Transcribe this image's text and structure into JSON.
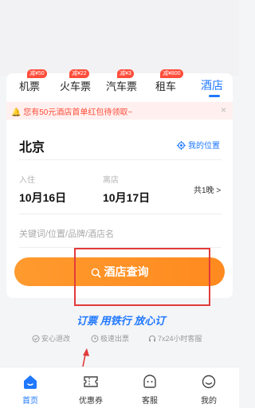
{
  "tabs": [
    {
      "label": "机票",
      "badge": "减¥50"
    },
    {
      "label": "火车票",
      "badge": "减¥22"
    },
    {
      "label": "汽车票",
      "badge": "减¥3"
    },
    {
      "label": "租车",
      "badge": "减¥800"
    },
    {
      "label": "酒店",
      "badge": ""
    }
  ],
  "promo": {
    "text": "您有50元酒店首单红包待领取~",
    "close": "×"
  },
  "destination": {
    "city": "北京",
    "my_location": "我的位置"
  },
  "dates": {
    "checkin_label": "入住",
    "checkin_date": "10月16日",
    "checkout_label": "离店",
    "checkout_date": "10月17日",
    "nights": "共1晚 >"
  },
  "keyword": {
    "placeholder": "关键词/位置/品牌/酒店名"
  },
  "search_button": {
    "label": "酒店查询"
  },
  "slogan": "订票 用铁行 放心订",
  "features": [
    "安心退改",
    "极速出票",
    "7x24小时客服"
  ],
  "bottom_nav": [
    {
      "label": "首页",
      "icon": "home-icon"
    },
    {
      "label": "优惠券",
      "icon": "coupon-icon"
    },
    {
      "label": "客服",
      "icon": "service-icon"
    },
    {
      "label": "我的",
      "icon": "profile-icon"
    }
  ],
  "colors": {
    "accent": "#1f78ff",
    "button": "#ff8a1f",
    "badge": "#ff4d3a",
    "annotation": "#e23b3b"
  }
}
